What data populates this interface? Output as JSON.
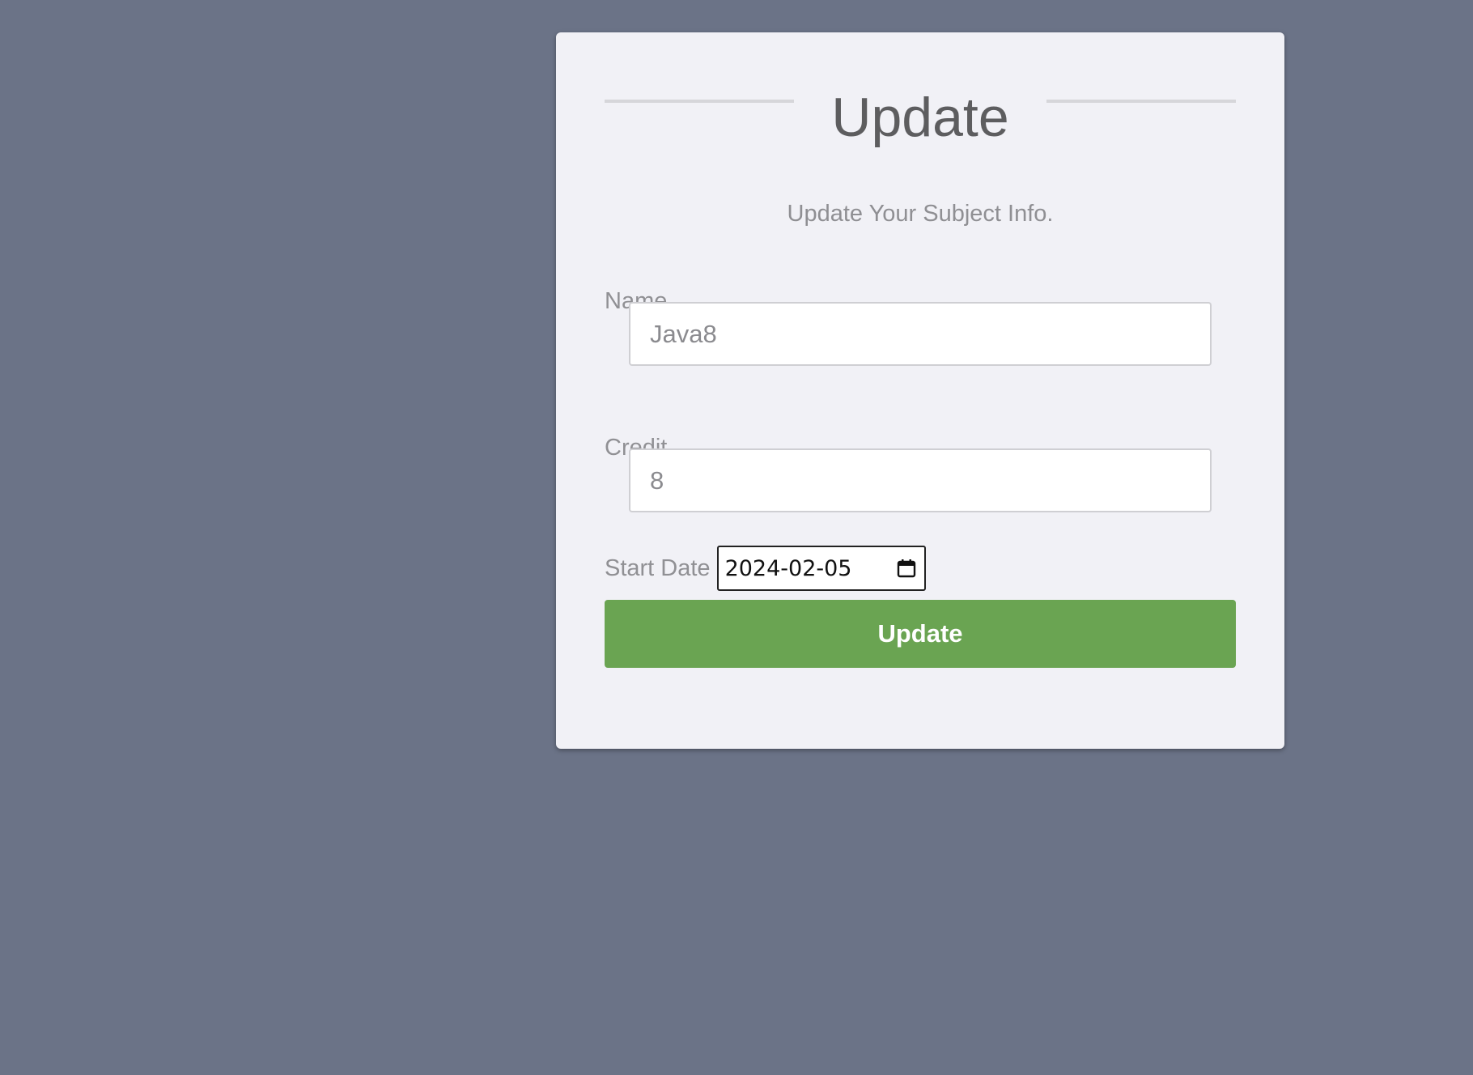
{
  "form": {
    "title": "Update",
    "subtitle": "Update Your Subject Info.",
    "fields": {
      "name": {
        "label": "Name",
        "value": "Java8"
      },
      "credit": {
        "label": "Credit",
        "value": "8"
      },
      "start_date": {
        "label": "Start Date",
        "value": "2024-02-05",
        "icon": "calendar-icon"
      }
    },
    "submit_label": "Update"
  },
  "colors": {
    "background": "#6b7387",
    "card": "#f1f1f6",
    "button": "#6aa452"
  }
}
